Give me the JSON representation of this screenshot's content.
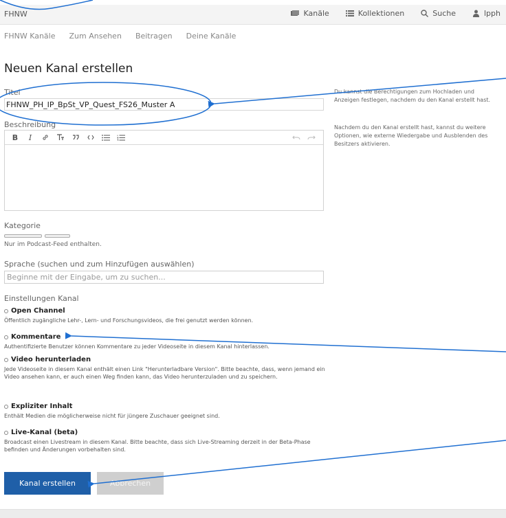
{
  "header": {
    "brand": "FHNW",
    "nav": [
      {
        "label": "Kanäle",
        "icon": "channels-icon"
      },
      {
        "label": "Kollektionen",
        "icon": "list-icon"
      },
      {
        "label": "Suche",
        "icon": "search-icon"
      },
      {
        "label": "lpph",
        "icon": "user-icon"
      }
    ]
  },
  "subnav": [
    "FHNW Kanäle",
    "Zum Ansehen",
    "Beitragen",
    "Deine Kanäle"
  ],
  "page": {
    "title": "Neuen Kanal erstellen"
  },
  "form": {
    "title_label": "Titel",
    "title_value": "FHNW_PH_IP_BpSt_VP_Quest_FS26_Muster A",
    "description_label": "Beschreibung",
    "category_label": "Kategorie",
    "category_hint": "Nur im Podcast-Feed enthalten.",
    "language_label": "Sprache (suchen und zum Hinzufügen auswählen)",
    "language_placeholder": "Beginne mit der Eingabe, um zu suchen...",
    "settings_label": "Einstellungen Kanal",
    "options": [
      {
        "title": "Open Channel",
        "desc": "Öffentlich zugängliche Lehr-, Lern- und Forschungsvideos, die frei genutzt werden können."
      },
      {
        "title": "Kommentare",
        "desc": "Authentifizierte Benutzer können Kommentare zu jeder Videoseite in diesem Kanal hinterlassen."
      },
      {
        "title": "Video herunterladen",
        "desc": "Jede Videoseite in diesem Kanal enthält einen Link \"Herunterladbare Version\". Bitte beachte, dass, wenn jemand ein Video ansehen kann, er auch einen Weg finden kann, das Video herunterzuladen und zu speichern."
      },
      {
        "title": "Expliziter Inhalt",
        "desc": "Enthält Medien die möglicherweise nicht für jüngere Zuschauer geeignet sind."
      },
      {
        "title": "Live-Kanal (beta)",
        "desc": "Broadcast einen Livestream in diesem Kanal. Bitte beachte, dass sich Live-Streaming derzeit in der Beta-Phase befinden und Änderungen vorbehalten sind."
      }
    ],
    "submit_label": "Kanal erstellen",
    "cancel_label": "Abbrechen"
  },
  "sidebar": {
    "note1": "Du kannst die Berechtigungen zum Hochladen und Anzeigen festlegen, nachdem du den Kanal erstellt hast.",
    "note2": "Nachdem du den Kanal erstellt hast, kannst du weitere Optionen, wie externe Wiedergabe und Ausblenden des Besitzers aktivieren."
  },
  "colors": {
    "primary_button": "#1f5fa8",
    "annotation": "#1f6fd1"
  }
}
